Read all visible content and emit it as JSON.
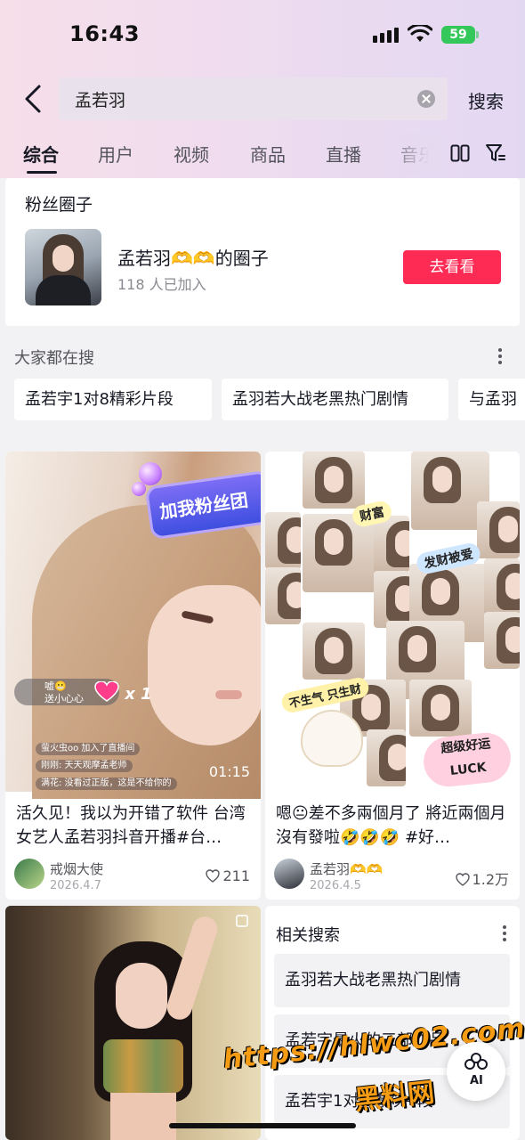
{
  "status_bar": {
    "time": "16:43",
    "battery": "59"
  },
  "search": {
    "query": "孟若羽",
    "submit_label": "搜索"
  },
  "tabs": [
    {
      "label": "综合",
      "active": true
    },
    {
      "label": "用户",
      "active": false
    },
    {
      "label": "视频",
      "active": false
    },
    {
      "label": "商品",
      "active": false
    },
    {
      "label": "直播",
      "active": false
    },
    {
      "label": "音乐",
      "active": false
    }
  ],
  "fan_circle": {
    "section_title": "粉丝圈子",
    "name": "孟若羽🫶🫶的圈子",
    "member_count": "118 人已加入",
    "button_label": "去看看"
  },
  "hot_searches": {
    "title": "大家都在搜",
    "chips": [
      "孟若宇1对8精彩片段",
      "孟羽若大战老黑热门剧情",
      "与孟羽"
    ]
  },
  "feed": [
    {
      "overlay_banner": "加我粉丝团",
      "live_name": "嘘😬",
      "live_sub": "送小心心",
      "gift_count": "x 1",
      "chat_lines": [
        "萤火虫oo 加入了直播间",
        "刚刚: 天天观摩孟老师",
        "满花: 没看过正版，这是不给你的"
      ],
      "duration": "01:15",
      "caption": "活久见！我以为开错了软件 台湾女艺人孟若羽抖音开播#台…",
      "author": "戒烟大使",
      "date": "2026.4.7",
      "likes": "211"
    },
    {
      "stickers": [
        "财富",
        "发财被爱",
        "不生气 只生财",
        "超级好运",
        "LUCK"
      ],
      "caption": "嗯😐差不多兩個月了 將近兩個月沒有發啦🤣🤣🤣 #好…",
      "author": "孟若羽🫶🫶",
      "date": "2026.4.5",
      "likes": "1.2万"
    }
  ],
  "related": {
    "title": "相关搜索",
    "items": [
      "孟羽若大战老黑热门剧情",
      "孟若宇最火的三部作品",
      "孟若宇1对8精彩片段"
    ]
  },
  "watermark": {
    "url": "https://hlwc02.com",
    "brand": "黑料网"
  },
  "ai_button": {
    "label": "AI"
  },
  "colors": {
    "accent": "#fe2c55",
    "battery": "#34c759",
    "watermark": "#f59c14"
  }
}
